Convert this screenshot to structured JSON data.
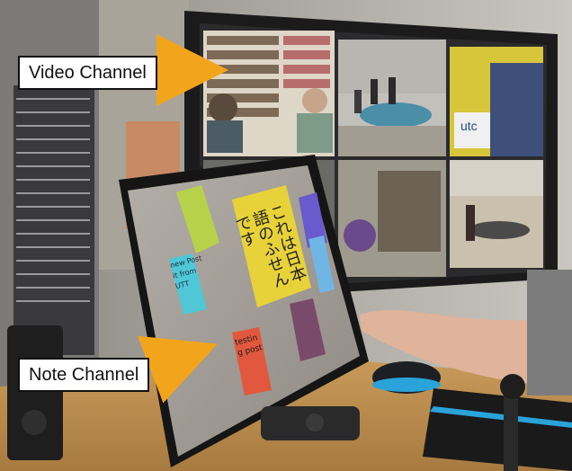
{
  "callouts": {
    "video_channel": "Video Channel",
    "note_channel": "Note Channel"
  },
  "notes": {
    "yellow_large": [
      "これは日本",
      "語のふせん",
      "です"
    ],
    "cyan": [
      "new Post",
      "it from",
      "UTT"
    ],
    "red": [
      "testin",
      "g post"
    ]
  },
  "video_sign": "utc",
  "colors": {
    "arrow": "#f2a51a",
    "note_yellow": "#e8d23a",
    "note_green": "#b7d24a",
    "note_cyan": "#4fc7d6",
    "note_purple": "#6a5acd",
    "note_lightblue": "#6fb6e6",
    "note_maroon": "#7a4a6a",
    "note_red": "#e2583e"
  }
}
